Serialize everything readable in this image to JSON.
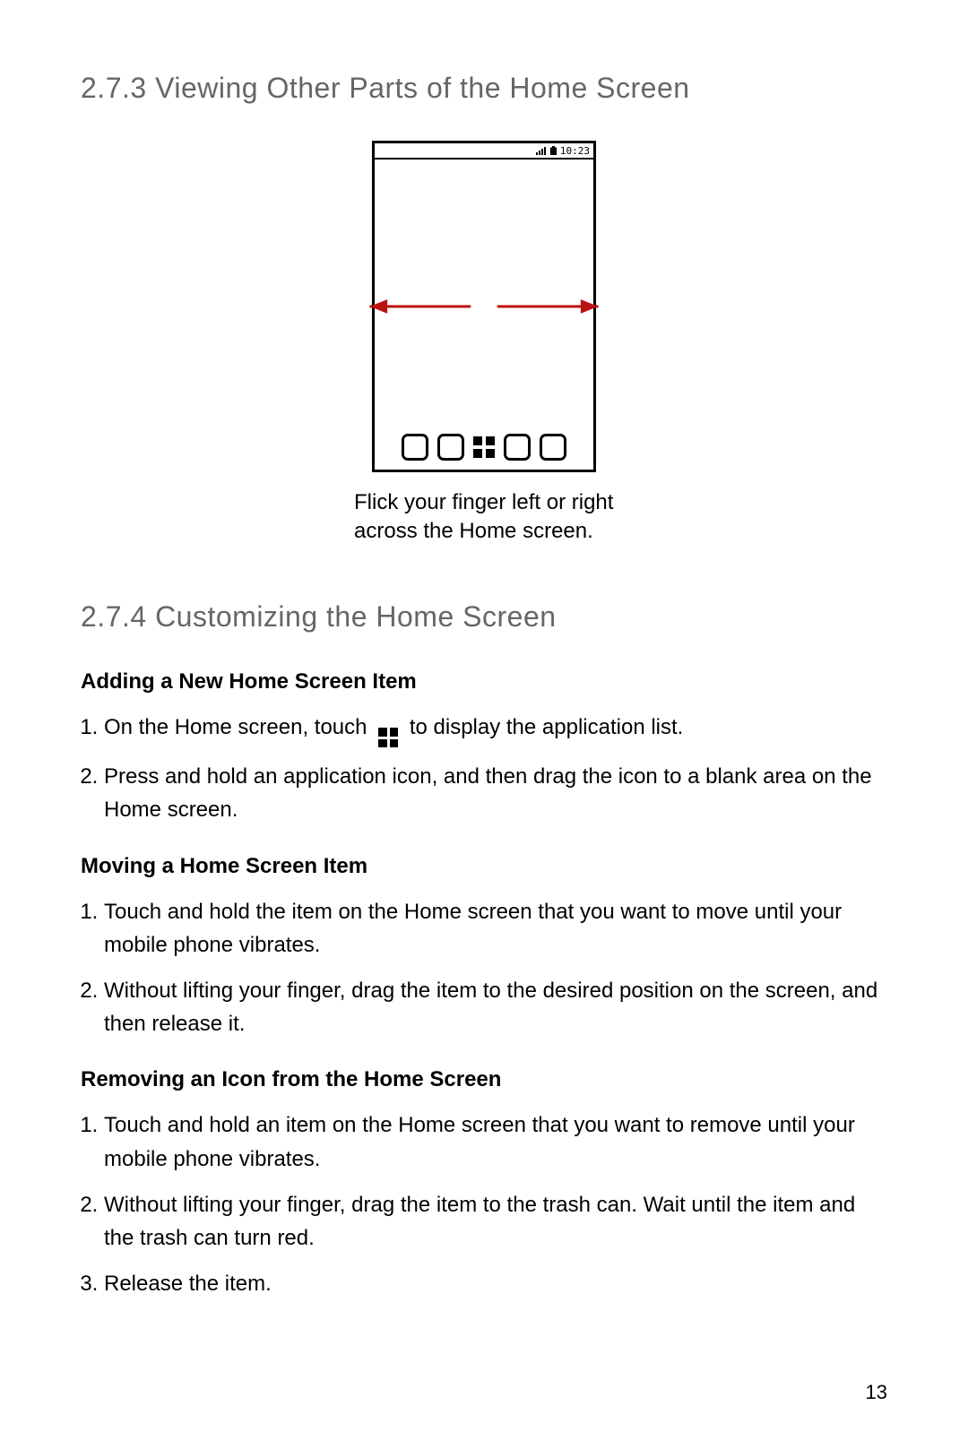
{
  "section273": {
    "heading": "2.7.3  Viewing Other Parts of the Home Screen"
  },
  "figure": {
    "status_time": "10:23",
    "caption": "Flick your finger left or right across the Home screen."
  },
  "section274": {
    "heading": "2.7.4  Customizing the Home Screen",
    "adding": {
      "title": "Adding a New Home Screen Item",
      "step1_a": "On the Home screen, touch",
      "step1_b": "to display the application list.",
      "step2": "Press and hold an application icon, and then drag the icon to a blank area on the Home screen."
    },
    "moving": {
      "title": "Moving a Home Screen Item",
      "step1": "Touch and hold the item on the Home screen that you want to move until your mobile phone vibrates.",
      "step2": "Without lifting your finger, drag the item to the desired position on the screen, and then release it."
    },
    "removing": {
      "title": "Removing an Icon from the Home Screen",
      "step1": "Touch and hold an item on the Home screen that you want to remove until your mobile phone vibrates.",
      "step2": "Without lifting your finger, drag the item to the trash can. Wait until the item and the trash can turn red.",
      "step3": "Release the item."
    }
  },
  "page_number": "13"
}
